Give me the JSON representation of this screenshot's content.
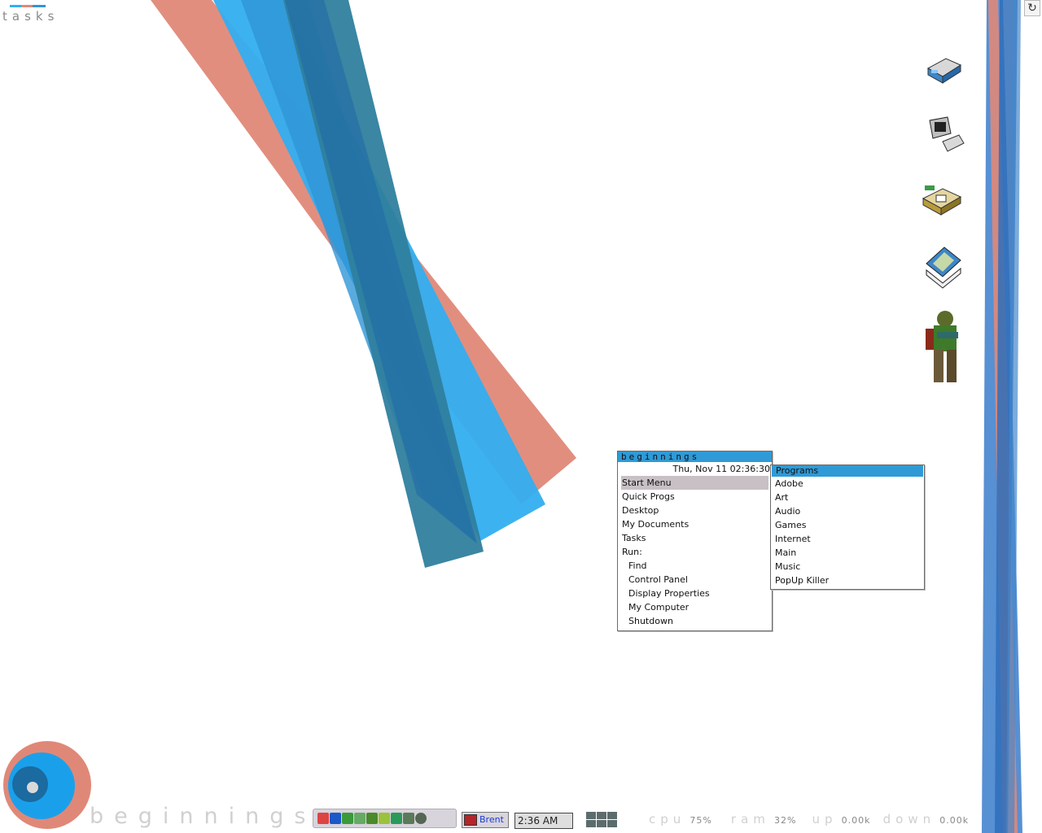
{
  "desktop": {
    "tasks_label": "tasks",
    "restore_icon": "restore-icon",
    "icons": [
      {
        "name": "printer-icon"
      },
      {
        "name": "computer-icon"
      },
      {
        "name": "scanner-icon"
      },
      {
        "name": "display-settings-icon"
      },
      {
        "name": "doom-marine-icon"
      }
    ]
  },
  "start_menu": {
    "title": "beginnings",
    "datetime": "Thu, Nov 11 02:36:30",
    "items": [
      {
        "label": "Start Menu",
        "selected": true
      },
      {
        "label": "Quick Progs"
      },
      {
        "label": "Desktop"
      },
      {
        "label": "My Documents"
      },
      {
        "label": "Tasks"
      },
      {
        "label": "Run:"
      },
      {
        "label": "Find"
      },
      {
        "label": "Control Panel"
      },
      {
        "label": "Display Properties"
      },
      {
        "label": "My Computer"
      },
      {
        "label": "Shutdown"
      }
    ]
  },
  "programs_menu": {
    "items": [
      "Programs",
      "Adobe",
      "Art",
      "Audio",
      "Games",
      "Internet",
      "Main",
      "Music",
      "PopUp Killer"
    ]
  },
  "taskbar": {
    "logo_text": "beginnings",
    "task_button": "Brent",
    "clock": "2:36 AM",
    "stats": {
      "cpu_label": "cpu",
      "cpu_value": "75%",
      "ram_label": "ram",
      "ram_value": "32%",
      "up_label": "up",
      "up_value": "0.00k",
      "down_label": "down",
      "down_value": "0.00k"
    }
  },
  "colors": {
    "salmon": "#e08878",
    "sky": "#33aef0",
    "mid_blue": "#2f95d6",
    "teal": "#2f7f9e",
    "dark_blue": "#1f6aa6",
    "menu_highlight": "#2f9ad6"
  }
}
